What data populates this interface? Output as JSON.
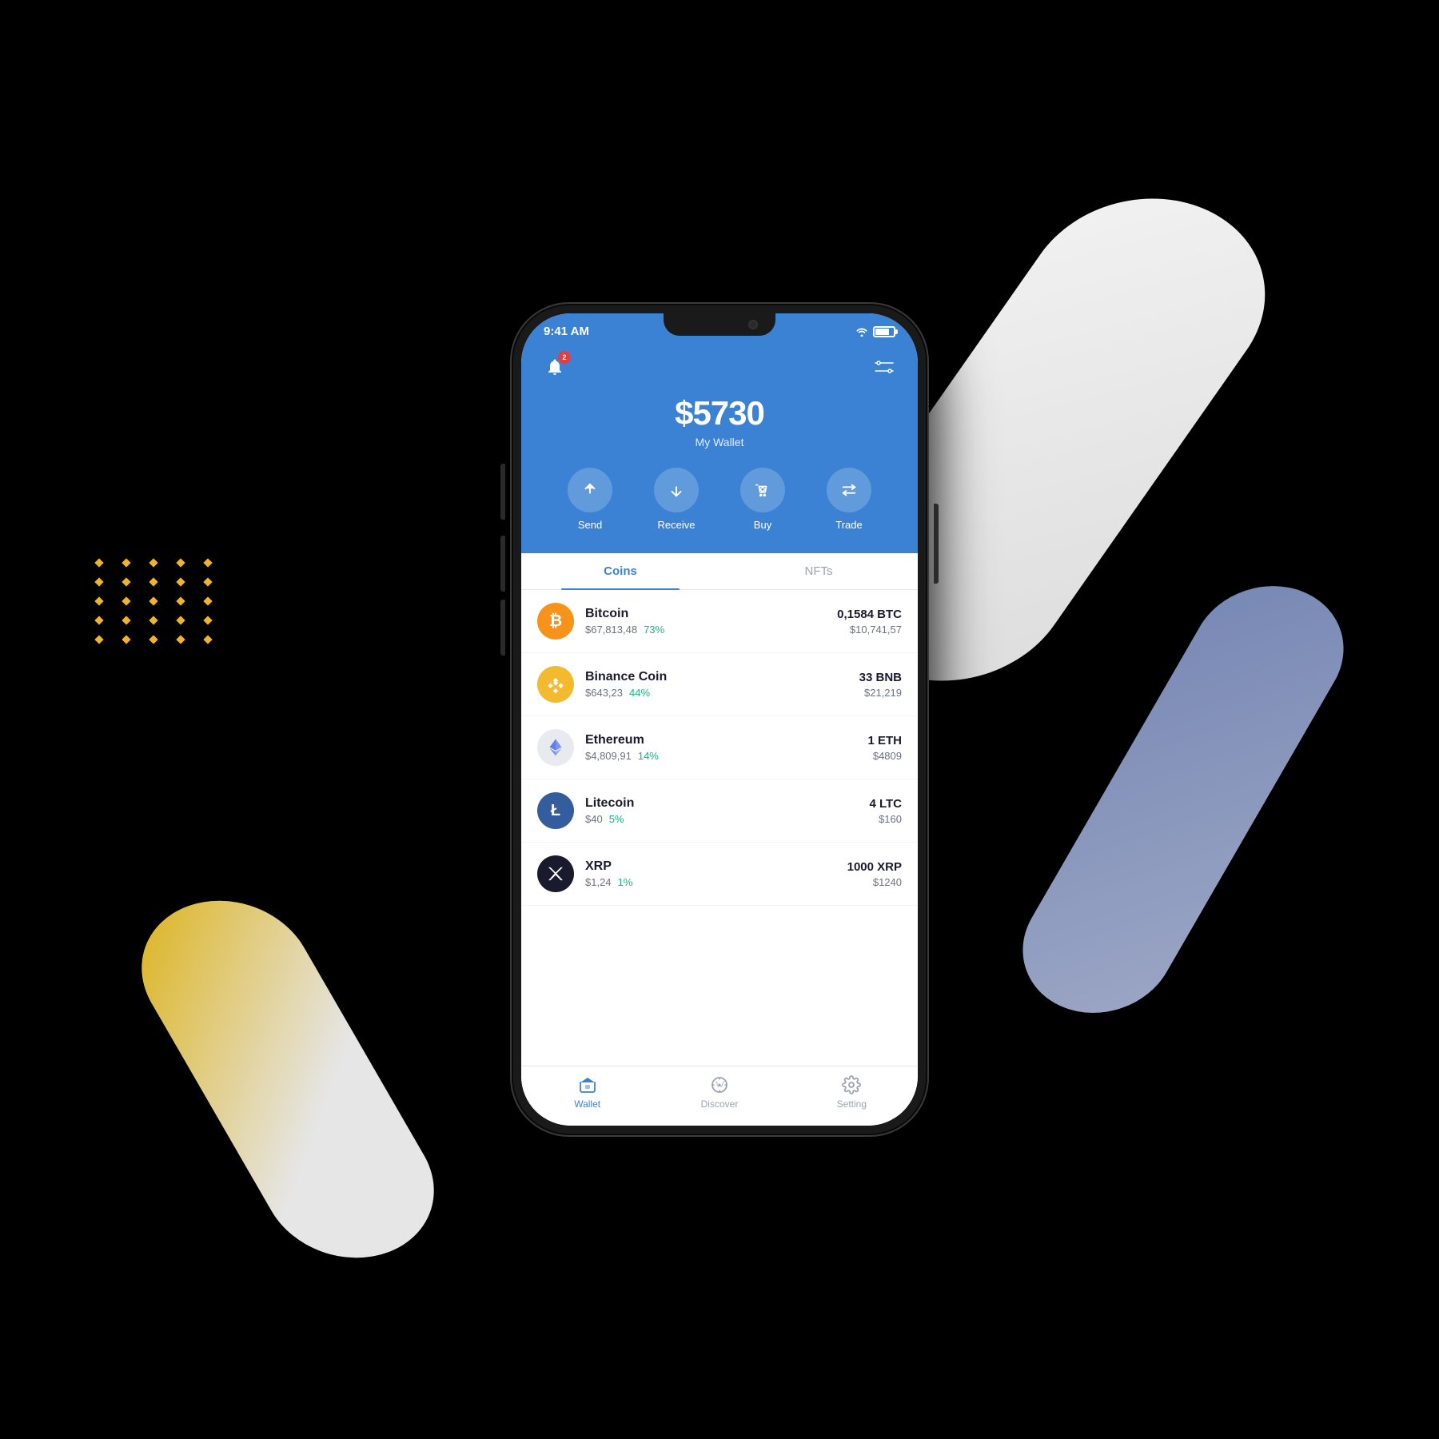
{
  "page": {
    "background": "#000"
  },
  "statusBar": {
    "time": "9:41 AM",
    "wifiLabel": "wifi",
    "batteryLabel": "battery"
  },
  "header": {
    "balance": "$5730",
    "balanceLabel": "My Wallet",
    "notificationCount": "2",
    "actions": [
      {
        "id": "send",
        "label": "Send"
      },
      {
        "id": "receive",
        "label": "Receive"
      },
      {
        "id": "buy",
        "label": "Buy"
      },
      {
        "id": "trade",
        "label": "Trade"
      }
    ]
  },
  "tabs": [
    {
      "id": "coins",
      "label": "Coins",
      "active": true
    },
    {
      "id": "nfts",
      "label": "NFTs",
      "active": false
    }
  ],
  "coins": [
    {
      "id": "btc",
      "name": "Bitcoin",
      "price": "$67,813,48",
      "change": "73%",
      "amount": "0,1584 BTC",
      "value": "$10,741,57",
      "symbol": "₿"
    },
    {
      "id": "bnb",
      "name": "Binance Coin",
      "price": "$643,23",
      "change": "44%",
      "amount": "33 BNB",
      "value": "$21,219",
      "symbol": "◈"
    },
    {
      "id": "eth",
      "name": "Ethereum",
      "price": "$4,809,91",
      "change": "14%",
      "amount": "1 ETH",
      "value": "$4809",
      "symbol": "⟠"
    },
    {
      "id": "ltc",
      "name": "Litecoin",
      "price": "$40",
      "change": "5%",
      "amount": "4 LTC",
      "value": "$160",
      "symbol": "Ł"
    },
    {
      "id": "xrp",
      "name": "XRP",
      "price": "$1,24",
      "change": "1%",
      "amount": "1000 XRP",
      "value": "$1240",
      "symbol": "✕"
    }
  ],
  "bottomNav": [
    {
      "id": "wallet",
      "label": "Wallet",
      "active": true
    },
    {
      "id": "discover",
      "label": "Discover",
      "active": false
    },
    {
      "id": "setting",
      "label": "Setting",
      "active": false
    }
  ]
}
